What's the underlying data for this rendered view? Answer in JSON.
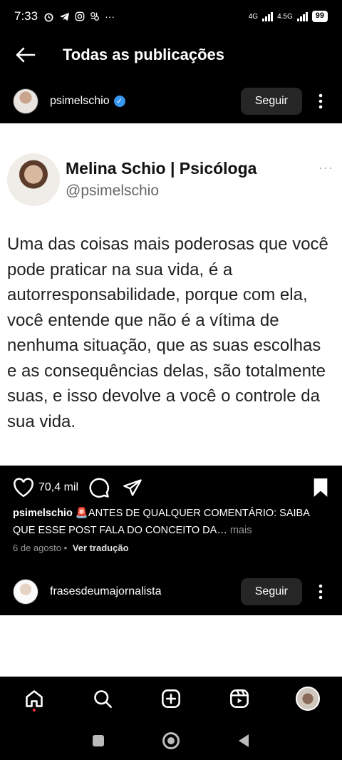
{
  "status_bar": {
    "time": "7:33",
    "network_1": "4G",
    "network_2": "4.5G",
    "battery": "99",
    "more_indicator": "···"
  },
  "topbar": {
    "title": "Todas as publicações"
  },
  "post": {
    "username": "psimelschio",
    "follow_label": "Seguir",
    "image": {
      "name": "Melina Schio | Psicóloga",
      "handle": "@psimelschio",
      "more": "···",
      "text": "Uma das coisas mais poderosas que você pode praticar na sua vida, é a autorresponsabilidade, porque com ela, você entende que não é a vítima de nenhuma situação, que as suas escolhas e as consequências delas, são totalmente suas, e isso devolve a você o controle da sua vida."
    },
    "likes": "70,4 mil",
    "caption_user": "psimelschio",
    "caption_text": " 🚨ANTES DE QUALQUER COMENTÁRIO: SAIBA QUE ESSE POST FALA DO CONCEITO DA…",
    "caption_more": " mais",
    "date": "6 de agosto",
    "separator": "•",
    "translate_label": "Ver tradução"
  },
  "post2": {
    "username": "frasesdeumajornalista",
    "follow_label": "Seguir"
  },
  "colors": {
    "background": "#000000",
    "button_bg": "#262626",
    "verified": "#3897f0",
    "notification_dot": "#ff3040"
  },
  "icons": [
    "back-arrow-icon",
    "verified-icon",
    "more-vertical-icon",
    "heart-icon",
    "comment-icon",
    "share-icon",
    "bookmark-icon",
    "home-icon",
    "search-icon",
    "create-icon",
    "reels-icon",
    "profile-avatar",
    "square-icon",
    "circle-icon",
    "triangle-back-icon"
  ]
}
